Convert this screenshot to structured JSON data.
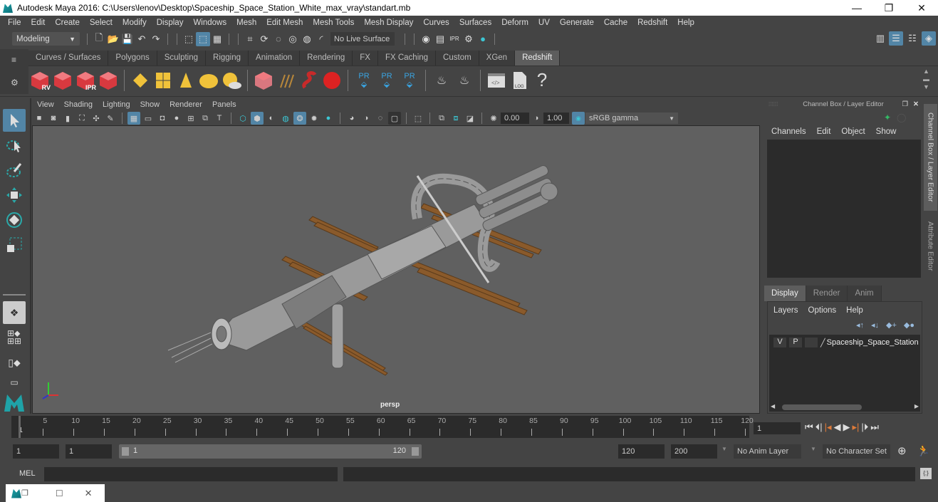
{
  "window": {
    "title": "Autodesk Maya 2016: C:\\Users\\lenov\\Desktop\\Spaceship_Space_Station_White_max_vray\\standart.mb",
    "controls": {
      "minimize": "—",
      "restore": "❐",
      "close": "✕"
    }
  },
  "menubar": [
    "File",
    "Edit",
    "Create",
    "Select",
    "Modify",
    "Display",
    "Windows",
    "Mesh",
    "Edit Mesh",
    "Mesh Tools",
    "Mesh Display",
    "Curves",
    "Surfaces",
    "Deform",
    "UV",
    "Generate",
    "Cache",
    "Redshift",
    "Help"
  ],
  "statusline": {
    "workspace": "Modeling",
    "live_surface": "No Live Surface"
  },
  "shelf": {
    "tabs": [
      "Curves / Surfaces",
      "Polygons",
      "Sculpting",
      "Rigging",
      "Animation",
      "Rendering",
      "FX",
      "FX Caching",
      "Custom",
      "XGen",
      "Redshift"
    ],
    "active_tab": "Redshift",
    "icons": [
      {
        "name": "redshift-renderview-icon",
        "label": "RV"
      },
      {
        "name": "redshift-batch-render-icon",
        "label": ""
      },
      {
        "name": "redshift-ipr-icon",
        "label": "IPR"
      },
      {
        "name": "redshift-render-settings-icon",
        "label": ""
      },
      {
        "name": "redshift-light-icon",
        "label": ""
      },
      {
        "name": "redshift-area-light-icon",
        "label": ""
      },
      {
        "name": "redshift-spot-icon",
        "label": ""
      },
      {
        "name": "redshift-dome-light-icon",
        "label": ""
      },
      {
        "name": "redshift-sun-sky-icon",
        "label": ""
      },
      {
        "name": "redshift-volume-icon",
        "label": ""
      },
      {
        "name": "redshift-hair-icon",
        "label": ""
      },
      {
        "name": "redshift-shader-icon",
        "label": ""
      },
      {
        "name": "redshift-material-ball-icon",
        "label": ""
      },
      {
        "name": "redshift-proxy-icon",
        "label": "PR"
      },
      {
        "name": "redshift-proxy-export-icon",
        "label": "PR"
      },
      {
        "name": "redshift-proxy-swap-icon",
        "label": "PR"
      },
      {
        "name": "redshift-cache-icon",
        "label": ""
      },
      {
        "name": "redshift-cache-single-icon",
        "label": ""
      },
      {
        "name": "redshift-script-editor-icon",
        "label": ""
      },
      {
        "name": "redshift-log-icon",
        "label": "LOG"
      },
      {
        "name": "help-icon",
        "label": "?"
      }
    ]
  },
  "viewport": {
    "menu": [
      "View",
      "Shading",
      "Lighting",
      "Show",
      "Renderer",
      "Panels"
    ],
    "exposure": "0.00",
    "gamma": "1.00",
    "color_space": "sRGB gamma",
    "camera_label": "persp",
    "axis": {
      "x": "X",
      "y": "Y",
      "z": "Z"
    }
  },
  "channel_box": {
    "title": "Channel Box / Layer Editor",
    "menu": [
      "Channels",
      "Edit",
      "Object",
      "Show"
    ]
  },
  "side_tabs": [
    "Channel Box / Layer Editor",
    "Attribute Editor"
  ],
  "layer_editor": {
    "tabs": [
      "Display",
      "Render",
      "Anim"
    ],
    "active_tab": "Display",
    "menu": [
      "Layers",
      "Options",
      "Help"
    ],
    "layers": [
      {
        "visible": "V",
        "playback": "P",
        "name": "Spaceship_Space_Station"
      }
    ]
  },
  "timeline": {
    "ticks": [
      1,
      5,
      10,
      15,
      20,
      25,
      30,
      35,
      40,
      45,
      50,
      55,
      60,
      65,
      70,
      75,
      80,
      85,
      90,
      95,
      100,
      105,
      110,
      115,
      120
    ],
    "visible_range": [
      1,
      120
    ],
    "current_frame": "1"
  },
  "range": {
    "start": "1",
    "playback_start": "1",
    "slider_start": "1",
    "slider_end": "120",
    "playback_end": "120",
    "end": "200",
    "anim_layer": "No Anim Layer",
    "character_set": "No Character Set"
  },
  "command_line": {
    "label": "MEL"
  },
  "colors": {
    "accent": "#5285a6",
    "maya_teal": "#1fa3a8",
    "keyframe_orange": "#e07b39"
  }
}
